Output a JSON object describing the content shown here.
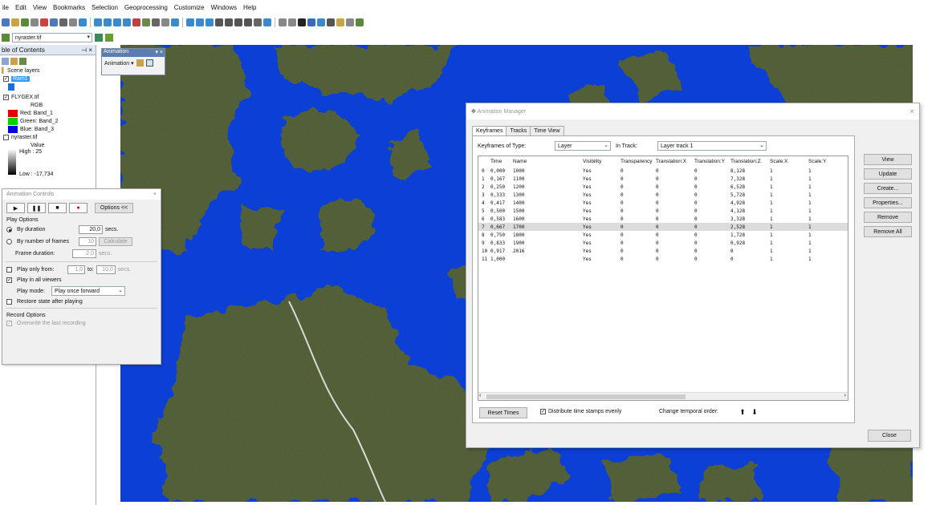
{
  "menubar": [
    "ile",
    "Edit",
    "View",
    "Bookmarks",
    "Selection",
    "Geoprocessing",
    "Customize",
    "Windows",
    "Help"
  ],
  "toolbar2": {
    "layer_combo": "nyraster.tif"
  },
  "toc": {
    "title": "ble of Contents",
    "pin": "p ×",
    "group": "Scene layers",
    "layer1": "Ram1",
    "layer2": "FLYGEX.tif",
    "rgb": "RGB",
    "bands": [
      {
        "label": "Red:  Band_1",
        "color": "#e60000"
      },
      {
        "label": "Green: Band_2",
        "color": "#00d200"
      },
      {
        "label": "Blue:  Band_3",
        "color": "#0000e6"
      }
    ],
    "layer3": "nyraster.tif",
    "value": "Value",
    "high": "High : 25",
    "low": "Low : -17,734"
  },
  "anim_toolbar": {
    "title": "Animation",
    "menu": "Animation ▾"
  },
  "anim_controls": {
    "title": "Animation Controls",
    "options_btn": "Options <<",
    "play_options": "Play Options",
    "by_duration": "By duration",
    "duration_value": "20,0",
    "secs": "secs.",
    "by_frames": "By number of frames",
    "frames_value": "10",
    "calculate": "Calculate",
    "frame_duration": "Frame duration:",
    "frame_duration_value": "2,0",
    "play_only": "Play only from:",
    "from_value": "1,0",
    "to": "to:",
    "to_value": "10,0",
    "secs2": "secs.",
    "play_all": "Play in all viewers",
    "play_mode": "Play mode:",
    "play_mode_value": "Play once forward",
    "restore": "Restore state after playing",
    "record_options": "Record Options",
    "overwrite": "Overwrite the last recording"
  },
  "anim_manager": {
    "title": "Animation Manager",
    "close_x": "×",
    "tabs": [
      "Keyframes",
      "Tracks",
      "Time View"
    ],
    "kf_type_label": "Keyframes of Type:",
    "kf_type_value": "Layer",
    "in_track_label": "In Track:",
    "in_track_value": "Layer track 1",
    "columns": [
      "Time",
      "Name",
      "Visibility",
      "Transparency",
      "Translation:X",
      "Translation:Y",
      "Translation:Z",
      "Scale:X",
      "Scale:Y"
    ],
    "rows": [
      {
        "i": "0",
        "time": "0,000",
        "name": "1000",
        "vis": "Yes",
        "tr": "0",
        "tx": "0",
        "ty": "0",
        "tz": "8,128",
        "sx": "1",
        "sy": "1"
      },
      {
        "i": "1",
        "time": "0,167",
        "name": "1100",
        "vis": "Yes",
        "tr": "0",
        "tx": "0",
        "ty": "0",
        "tz": "7,328",
        "sx": "1",
        "sy": "1"
      },
      {
        "i": "2",
        "time": "0,250",
        "name": "1200",
        "vis": "Yes",
        "tr": "0",
        "tx": "0",
        "ty": "0",
        "tz": "6,528",
        "sx": "1",
        "sy": "1"
      },
      {
        "i": "3",
        "time": "0,333",
        "name": "1300",
        "vis": "Yes",
        "tr": "0",
        "tx": "0",
        "ty": "0",
        "tz": "5,728",
        "sx": "1",
        "sy": "1"
      },
      {
        "i": "4",
        "time": "0,417",
        "name": "1400",
        "vis": "Yes",
        "tr": "0",
        "tx": "0",
        "ty": "0",
        "tz": "4,928",
        "sx": "1",
        "sy": "1"
      },
      {
        "i": "5",
        "time": "0,500",
        "name": "1500",
        "vis": "Yes",
        "tr": "0",
        "tx": "0",
        "ty": "0",
        "tz": "4,128",
        "sx": "1",
        "sy": "1"
      },
      {
        "i": "6",
        "time": "0,583",
        "name": "1600",
        "vis": "Yes",
        "tr": "0",
        "tx": "0",
        "ty": "0",
        "tz": "3,328",
        "sx": "1",
        "sy": "1"
      },
      {
        "i": "7",
        "time": "0,667",
        "name": "1700",
        "vis": "Yes",
        "tr": "0",
        "tx": "0",
        "ty": "0",
        "tz": "2,528",
        "sx": "1",
        "sy": "1"
      },
      {
        "i": "8",
        "time": "0,750",
        "name": "1800",
        "vis": "Yes",
        "tr": "0",
        "tx": "0",
        "ty": "0",
        "tz": "1,728",
        "sx": "1",
        "sy": "1"
      },
      {
        "i": "9",
        "time": "0,833",
        "name": "1900",
        "vis": "Yes",
        "tr": "0",
        "tx": "0",
        "ty": "0",
        "tz": "0,928",
        "sx": "1",
        "sy": "1"
      },
      {
        "i": "10",
        "time": "0,917",
        "name": "2016",
        "vis": "Yes",
        "tr": "0",
        "tx": "0",
        "ty": "0",
        "tz": "0",
        "sx": "1",
        "sy": "1"
      },
      {
        "i": "11",
        "time": "1,000",
        "name": "",
        "vis": "Yes",
        "tr": "0",
        "tx": "0",
        "ty": "0",
        "tz": "0",
        "sx": "1",
        "sy": "1"
      }
    ],
    "selected_row": 7,
    "side_buttons": [
      "View",
      "Update",
      "Create...",
      "Properties...",
      "Remove",
      "Remove All"
    ],
    "reset_times": "Reset Times",
    "distribute": "Distribute time stamps evenly",
    "change_order": "Change temporal order:",
    "close_btn": "Close"
  },
  "colors": {
    "water": "#0b3fd6",
    "land": "#4d5a2f",
    "highlight": "#3399ff"
  }
}
